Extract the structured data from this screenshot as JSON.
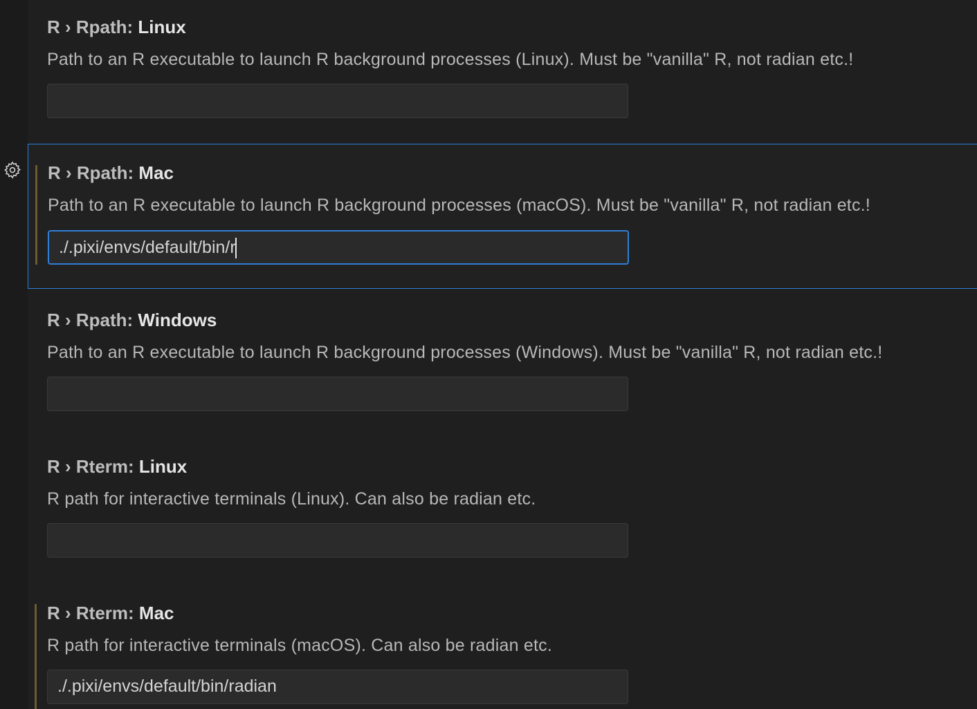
{
  "settings": [
    {
      "prefix": "R › Rpath: ",
      "key": "Linux",
      "description": "Path to an R executable to launch R background processes (Linux). Must be \"vanilla\" R, not radian etc.!",
      "value": ""
    },
    {
      "prefix": "R › Rpath: ",
      "key": "Mac",
      "description": "Path to an R executable to launch R background processes (macOS). Must be \"vanilla\" R, not radian etc.!",
      "value": "./.pixi/envs/default/bin/r"
    },
    {
      "prefix": "R › Rpath: ",
      "key": "Windows",
      "description": "Path to an R executable to launch R background processes (Windows). Must be \"vanilla\" R, not radian etc.!",
      "value": ""
    },
    {
      "prefix": "R › Rterm: ",
      "key": "Linux",
      "description": "R path for interactive terminals (Linux). Can also be radian etc.",
      "value": ""
    },
    {
      "prefix": "R › Rterm: ",
      "key": "Mac",
      "description": "R path for interactive terminals (macOS). Can also be radian etc.",
      "value": "./.pixi/envs/default/bin/radian"
    }
  ],
  "icons": {
    "settings_gear": "gear-icon"
  },
  "colors": {
    "focus_border": "#2f7fd8",
    "modified_bar": "#6b5b2f",
    "background": "#1f1f1f"
  }
}
